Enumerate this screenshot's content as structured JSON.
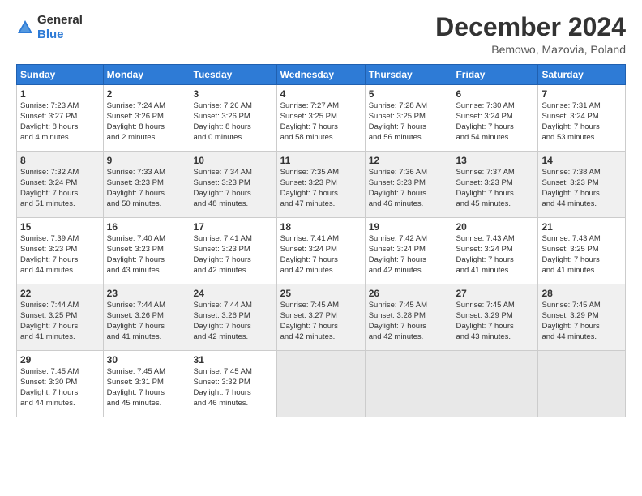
{
  "logo": {
    "text_general": "General",
    "text_blue": "Blue"
  },
  "title": "December 2024",
  "subtitle": "Bemowo, Mazovia, Poland",
  "headers": [
    "Sunday",
    "Monday",
    "Tuesday",
    "Wednesday",
    "Thursday",
    "Friday",
    "Saturday"
  ],
  "weeks": [
    [
      {
        "day": "1",
        "info": "Sunrise: 7:23 AM\nSunset: 3:27 PM\nDaylight: 8 hours\nand 4 minutes."
      },
      {
        "day": "2",
        "info": "Sunrise: 7:24 AM\nSunset: 3:26 PM\nDaylight: 8 hours\nand 2 minutes."
      },
      {
        "day": "3",
        "info": "Sunrise: 7:26 AM\nSunset: 3:26 PM\nDaylight: 8 hours\nand 0 minutes."
      },
      {
        "day": "4",
        "info": "Sunrise: 7:27 AM\nSunset: 3:25 PM\nDaylight: 7 hours\nand 58 minutes."
      },
      {
        "day": "5",
        "info": "Sunrise: 7:28 AM\nSunset: 3:25 PM\nDaylight: 7 hours\nand 56 minutes."
      },
      {
        "day": "6",
        "info": "Sunrise: 7:30 AM\nSunset: 3:24 PM\nDaylight: 7 hours\nand 54 minutes."
      },
      {
        "day": "7",
        "info": "Sunrise: 7:31 AM\nSunset: 3:24 PM\nDaylight: 7 hours\nand 53 minutes."
      }
    ],
    [
      {
        "day": "8",
        "info": "Sunrise: 7:32 AM\nSunset: 3:24 PM\nDaylight: 7 hours\nand 51 minutes."
      },
      {
        "day": "9",
        "info": "Sunrise: 7:33 AM\nSunset: 3:23 PM\nDaylight: 7 hours\nand 50 minutes."
      },
      {
        "day": "10",
        "info": "Sunrise: 7:34 AM\nSunset: 3:23 PM\nDaylight: 7 hours\nand 48 minutes."
      },
      {
        "day": "11",
        "info": "Sunrise: 7:35 AM\nSunset: 3:23 PM\nDaylight: 7 hours\nand 47 minutes."
      },
      {
        "day": "12",
        "info": "Sunrise: 7:36 AM\nSunset: 3:23 PM\nDaylight: 7 hours\nand 46 minutes."
      },
      {
        "day": "13",
        "info": "Sunrise: 7:37 AM\nSunset: 3:23 PM\nDaylight: 7 hours\nand 45 minutes."
      },
      {
        "day": "14",
        "info": "Sunrise: 7:38 AM\nSunset: 3:23 PM\nDaylight: 7 hours\nand 44 minutes."
      }
    ],
    [
      {
        "day": "15",
        "info": "Sunrise: 7:39 AM\nSunset: 3:23 PM\nDaylight: 7 hours\nand 44 minutes."
      },
      {
        "day": "16",
        "info": "Sunrise: 7:40 AM\nSunset: 3:23 PM\nDaylight: 7 hours\nand 43 minutes."
      },
      {
        "day": "17",
        "info": "Sunrise: 7:41 AM\nSunset: 3:23 PM\nDaylight: 7 hours\nand 42 minutes."
      },
      {
        "day": "18",
        "info": "Sunrise: 7:41 AM\nSunset: 3:24 PM\nDaylight: 7 hours\nand 42 minutes."
      },
      {
        "day": "19",
        "info": "Sunrise: 7:42 AM\nSunset: 3:24 PM\nDaylight: 7 hours\nand 42 minutes."
      },
      {
        "day": "20",
        "info": "Sunrise: 7:43 AM\nSunset: 3:24 PM\nDaylight: 7 hours\nand 41 minutes."
      },
      {
        "day": "21",
        "info": "Sunrise: 7:43 AM\nSunset: 3:25 PM\nDaylight: 7 hours\nand 41 minutes."
      }
    ],
    [
      {
        "day": "22",
        "info": "Sunrise: 7:44 AM\nSunset: 3:25 PM\nDaylight: 7 hours\nand 41 minutes."
      },
      {
        "day": "23",
        "info": "Sunrise: 7:44 AM\nSunset: 3:26 PM\nDaylight: 7 hours\nand 41 minutes."
      },
      {
        "day": "24",
        "info": "Sunrise: 7:44 AM\nSunset: 3:26 PM\nDaylight: 7 hours\nand 42 minutes."
      },
      {
        "day": "25",
        "info": "Sunrise: 7:45 AM\nSunset: 3:27 PM\nDaylight: 7 hours\nand 42 minutes."
      },
      {
        "day": "26",
        "info": "Sunrise: 7:45 AM\nSunset: 3:28 PM\nDaylight: 7 hours\nand 42 minutes."
      },
      {
        "day": "27",
        "info": "Sunrise: 7:45 AM\nSunset: 3:29 PM\nDaylight: 7 hours\nand 43 minutes."
      },
      {
        "day": "28",
        "info": "Sunrise: 7:45 AM\nSunset: 3:29 PM\nDaylight: 7 hours\nand 44 minutes."
      }
    ],
    [
      {
        "day": "29",
        "info": "Sunrise: 7:45 AM\nSunset: 3:30 PM\nDaylight: 7 hours\nand 44 minutes."
      },
      {
        "day": "30",
        "info": "Sunrise: 7:45 AM\nSunset: 3:31 PM\nDaylight: 7 hours\nand 45 minutes."
      },
      {
        "day": "31",
        "info": "Sunrise: 7:45 AM\nSunset: 3:32 PM\nDaylight: 7 hours\nand 46 minutes."
      },
      {
        "day": "",
        "info": ""
      },
      {
        "day": "",
        "info": ""
      },
      {
        "day": "",
        "info": ""
      },
      {
        "day": "",
        "info": ""
      }
    ]
  ]
}
